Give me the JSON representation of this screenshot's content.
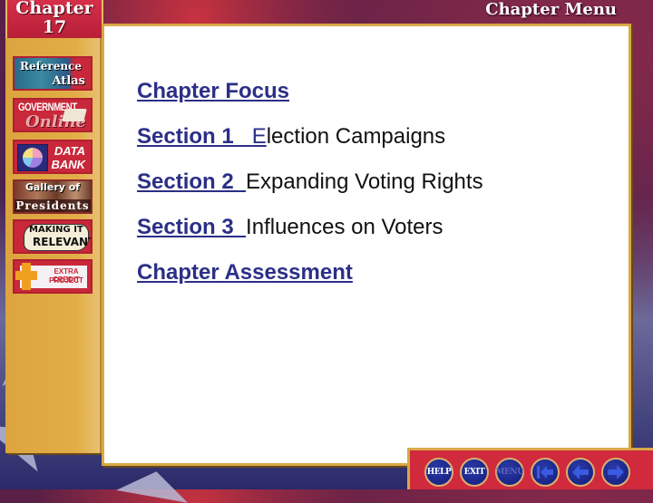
{
  "header": {
    "chapter_label": "Chapter",
    "chapter_number": "17",
    "chapter_menu_label": "Chapter Menu"
  },
  "sidebar": {
    "items": [
      {
        "id": "reference-atlas",
        "line1": "Reference",
        "line2": "Atlas"
      },
      {
        "id": "government-online",
        "line1": "GOVERNMENT",
        "line2": "Online"
      },
      {
        "id": "data-bank",
        "line1": "DATA",
        "line2": "BANK"
      },
      {
        "id": "gallery-of-presidents",
        "line1": "Gallery of",
        "line2": "Presidents"
      },
      {
        "id": "making-it-relevant",
        "line1": "MAKING IT",
        "line2": "RELEVANT"
      },
      {
        "id": "extra-credit-project",
        "line1": "EXTRA CREDIT",
        "line2": "PROJECT"
      }
    ]
  },
  "main": {
    "links": [
      {
        "link": "Chapter Focus",
        "link_thin": "",
        "desc": ""
      },
      {
        "link": "Section 1   ",
        "link_thin": "E",
        "desc": "lection Campaigns"
      },
      {
        "link": "Section 2  ",
        "link_thin": "",
        "desc": "Expanding Voting Rights"
      },
      {
        "link": "Section 3  ",
        "link_thin": "",
        "desc": "Influences on Voters"
      },
      {
        "link": "Chapter Assessment",
        "link_thin": "",
        "desc": ""
      }
    ]
  },
  "navbar": {
    "buttons": [
      {
        "id": "help",
        "label": "HELP",
        "icon": "text"
      },
      {
        "id": "exit",
        "label": "EXIT",
        "icon": "text"
      },
      {
        "id": "menu",
        "label": "MENU",
        "icon": "text",
        "disabled": true
      },
      {
        "id": "first",
        "label": "",
        "icon": "arrow-left-bar-icon"
      },
      {
        "id": "back",
        "label": "",
        "icon": "arrow-left-icon"
      },
      {
        "id": "forward",
        "label": "",
        "icon": "arrow-right-icon"
      }
    ]
  },
  "colors": {
    "link": "#2b2f86",
    "sidebar_gold": "#dca43e",
    "accent_red": "#d02a3c",
    "nav_button_blue": "#141c78"
  }
}
